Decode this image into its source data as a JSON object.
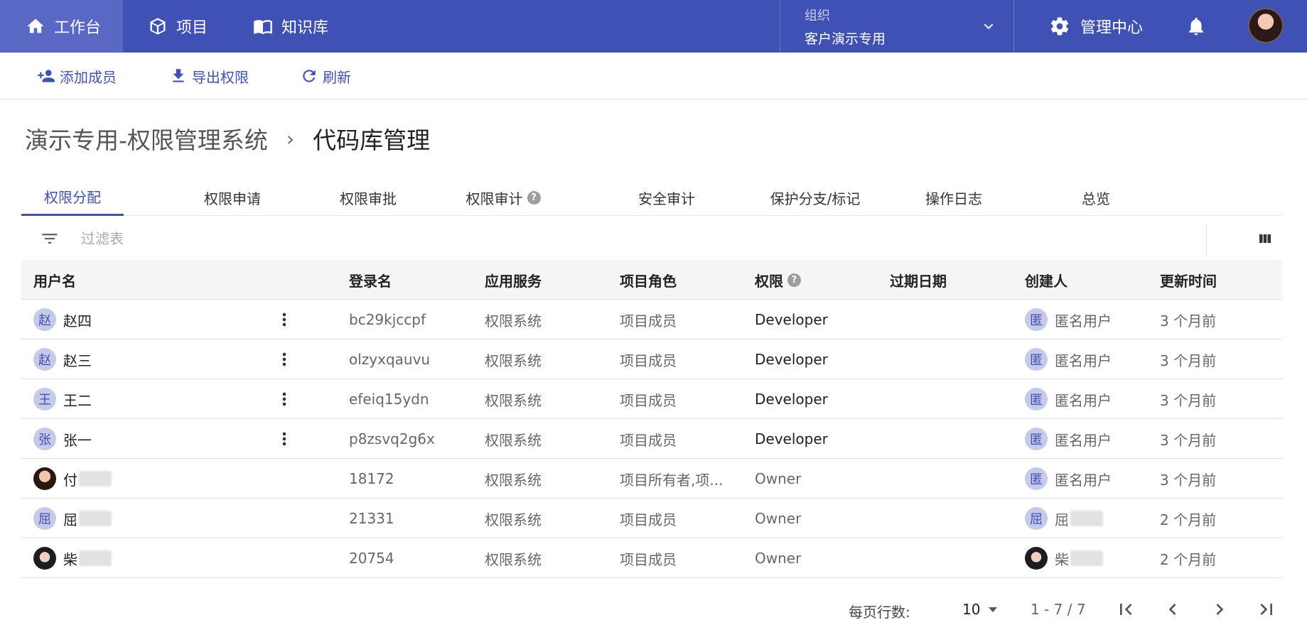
{
  "topnav": {
    "items": [
      {
        "label": "工作台",
        "icon": "home-icon"
      },
      {
        "label": "项目",
        "icon": "cube-icon"
      },
      {
        "label": "知识库",
        "icon": "book-icon"
      }
    ],
    "org_label": "组织",
    "org_value": "客户演示专用",
    "admin_label": "管理中心"
  },
  "toolbar": {
    "add_member": "添加成员",
    "export": "导出权限",
    "refresh": "刷新"
  },
  "breadcrumb": {
    "parent": "演示专用-权限管理系统",
    "separator": "›",
    "current": "代码库管理"
  },
  "tabs": [
    "权限分配",
    "权限申请",
    "权限审批",
    "权限审计",
    "安全审计",
    "保护分支/标记",
    "操作日志",
    "总览"
  ],
  "filter": {
    "placeholder": "过滤表"
  },
  "table": {
    "headers": [
      "用户名",
      "登录名",
      "应用服务",
      "项目角色",
      "权限",
      "过期日期",
      "创建人",
      "更新时间"
    ],
    "rows": [
      {
        "avatar": "赵",
        "user": "赵四",
        "login": "bc29kjccpf",
        "service": "权限系统",
        "role": "项目成员",
        "perm": "Developer",
        "expire": "",
        "creator_avatar": "匿",
        "creator": "匿名用户",
        "updated": "3 个月前"
      },
      {
        "avatar": "赵",
        "user": "赵三",
        "login": "olzyxqauvu",
        "service": "权限系统",
        "role": "项目成员",
        "perm": "Developer",
        "expire": "",
        "creator_avatar": "匿",
        "creator": "匿名用户",
        "updated": "3 个月前"
      },
      {
        "avatar": "王",
        "user": "王二",
        "login": "efeiq15ydn",
        "service": "权限系统",
        "role": "项目成员",
        "perm": "Developer",
        "expire": "",
        "creator_avatar": "匿",
        "creator": "匿名用户",
        "updated": "3 个月前"
      },
      {
        "avatar": "张",
        "user": "张一",
        "login": "p8zsvq2g6x",
        "service": "权限系统",
        "role": "项目成员",
        "perm": "Developer",
        "expire": "",
        "creator_avatar": "匿",
        "creator": "匿名用户",
        "updated": "3 个月前"
      },
      {
        "avatar": "",
        "user": "付",
        "login": "18172",
        "service": "权限系统",
        "role": "项目所有者,项...",
        "perm": "Owner",
        "expire": "",
        "creator_avatar": "匿",
        "creator": "匿名用户",
        "updated": "3 个月前"
      },
      {
        "avatar": "屈",
        "user": "屈",
        "login": "21331",
        "service": "权限系统",
        "role": "项目成员",
        "perm": "Owner",
        "expire": "",
        "creator_avatar": "屈",
        "creator": "屈",
        "updated": "2 个月前"
      },
      {
        "avatar": "",
        "user": "柴",
        "login": "20754",
        "service": "权限系统",
        "role": "项目成员",
        "perm": "Owner",
        "expire": "",
        "creator_avatar": "",
        "creator": "柴",
        "updated": "2 个月前"
      }
    ]
  },
  "pagination": {
    "rows_per_page_label": "每页行数:",
    "rows_per_page": "10",
    "range": "1 - 7 / 7"
  },
  "colors": {
    "primary": "#3f51b5",
    "nav_active": "#5868c4"
  }
}
